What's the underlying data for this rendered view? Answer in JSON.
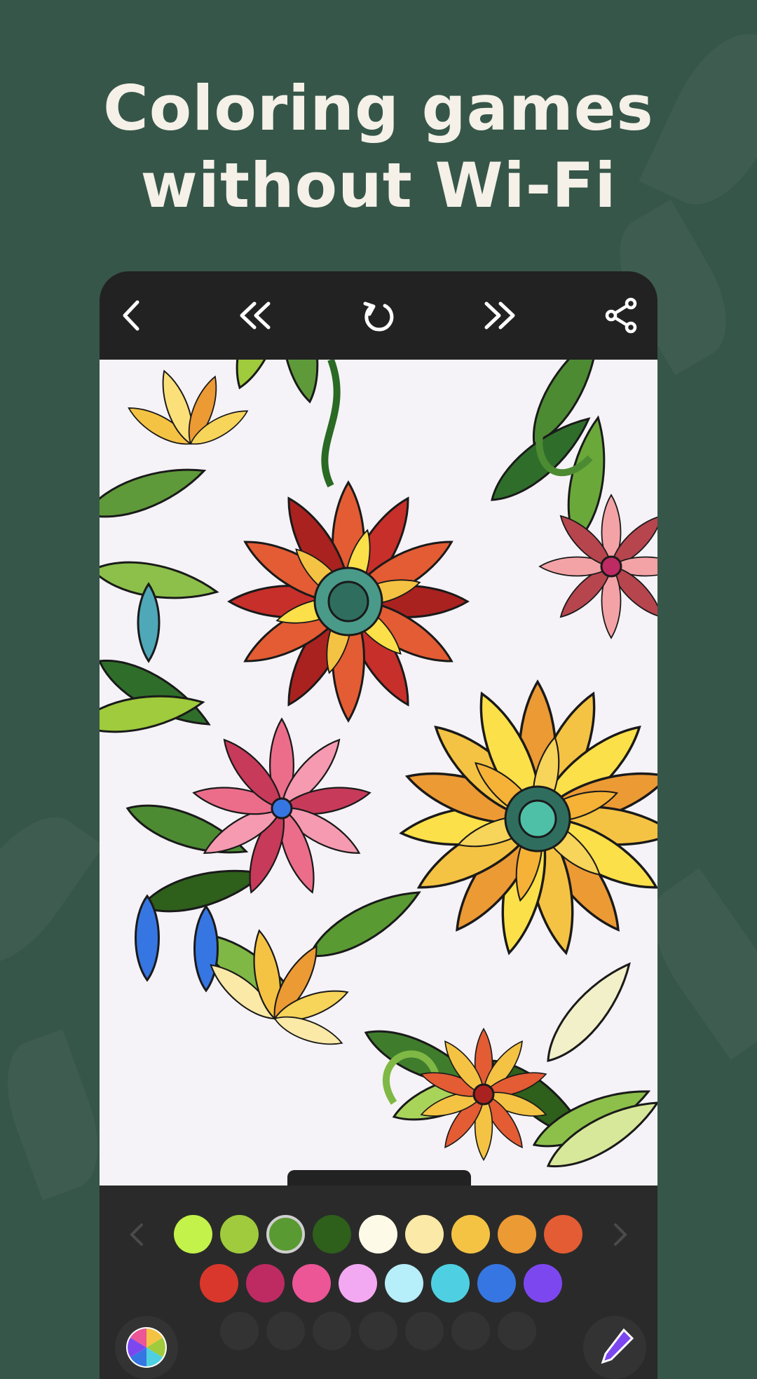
{
  "headline": {
    "line1": "Coloring games",
    "line2": "without Wi-Fi"
  },
  "toolbar": {
    "icons": [
      "back-arrow-icon",
      "double-left-icon",
      "reset-icon",
      "double-right-icon",
      "share-icon"
    ]
  },
  "palette": {
    "row1": [
      "#c3f24a",
      "#9fcb3c",
      "#5a9a32",
      "#2e5f1b",
      "#fdfbe8",
      "#fbe9a7",
      "#f5c343",
      "#ec9a34",
      "#e35c34"
    ],
    "row2": [
      "#d9372c",
      "#be2a62",
      "#ec5596",
      "#f3a8f2",
      "#b6eefa",
      "#4fd0e2",
      "#3676e2",
      "#7d47f0"
    ],
    "selected_index": 2,
    "empty_slots": 7
  },
  "colors": {
    "background": "#365649",
    "phone": "#222222",
    "canvas": "#f5f3f7"
  }
}
